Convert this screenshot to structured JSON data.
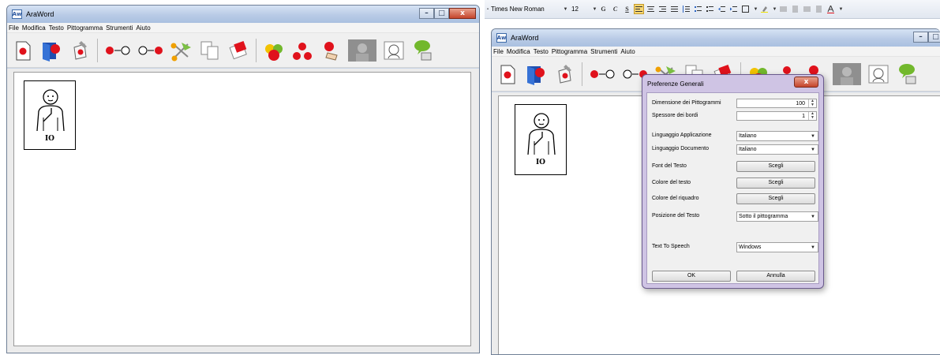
{
  "left_window": {
    "title": "AraWord",
    "app_icon_text": "Aw",
    "caption_buttons": {
      "minimize": "–",
      "maximize": "□",
      "close": "x"
    },
    "menu": [
      "File",
      "Modifica",
      "Testo",
      "Pittogramma",
      "Strumenti",
      "Aiuto"
    ],
    "pictogram_label": "IO"
  },
  "right_window": {
    "title": "AraWord",
    "app_icon_text": "Aw",
    "menu": [
      "File",
      "Modifica",
      "Testo",
      "Pittogramma",
      "Strumenti",
      "Aiuto"
    ],
    "pictogram_label": "IO"
  },
  "format_toolbar": {
    "font_name": "Times New Roman",
    "font_size": "12",
    "bold": "G",
    "italic": "C",
    "underline": "S"
  },
  "dialog": {
    "title": "Preferenze Generali",
    "close_label": "x",
    "pictogram_size_label": "Dimensione dei Pittogrammi",
    "pictogram_size_value": "100",
    "border_thickness_label": "Spessore dei bordi",
    "border_thickness_value": "1",
    "app_language_label": "Linguaggio Applicazione",
    "app_language_value": "Italiano",
    "doc_language_label": "Linguaggio Documento",
    "doc_language_value": "Italiano",
    "text_font_label": "Font del Testo",
    "text_color_label": "Colore del testo",
    "frame_color_label": "Colore del riquadro",
    "choose_label": "Scegli",
    "text_position_label": "Posizione del Testo",
    "text_position_value": "Sotto il pittogramma",
    "tts_label": "Text To Speech",
    "tts_value": "Windows",
    "ok_label": "OK",
    "cancel_label": "Annulla"
  },
  "colors": {
    "titlebar": "#b9cbe6",
    "dialog_frame": "#cfc4e4",
    "close_button": "#c5442b",
    "doc_background": "#ececec"
  },
  "toolbar_icons": [
    "new-document-icon",
    "open-document-icon",
    "save-icon",
    "previous-word-icon",
    "next-word-icon",
    "cut-icon",
    "copy-icon",
    "paste-icon",
    "fruit-group-icon",
    "apples-icon",
    "apple-hand-icon",
    "grayscale-pictogram-icon",
    "face-icon",
    "speak-icon"
  ]
}
